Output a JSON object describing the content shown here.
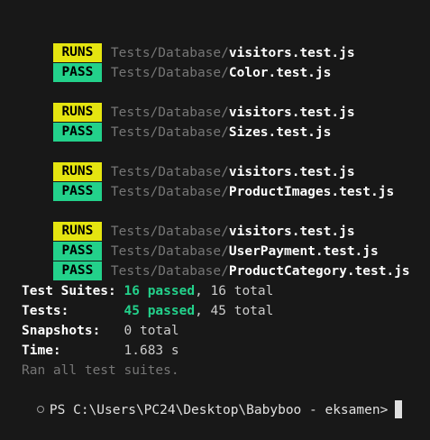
{
  "results": [
    {
      "status": "RUNS",
      "dir": "Tests/Database/",
      "file": "visitors.test.js"
    },
    {
      "status": "PASS",
      "dir": "Tests/Database/",
      "file": "Color.test.js"
    },
    {
      "status": "RUNS",
      "dir": "Tests/Database/",
      "file": "visitors.test.js"
    },
    {
      "status": "PASS",
      "dir": "Tests/Database/",
      "file": "Sizes.test.js"
    },
    {
      "status": "RUNS",
      "dir": "Tests/Database/",
      "file": "visitors.test.js"
    },
    {
      "status": "PASS",
      "dir": "Tests/Database/",
      "file": "ProductImages.test.js"
    },
    {
      "status": "RUNS",
      "dir": "Tests/Database/",
      "file": "visitors.test.js"
    },
    {
      "status": "PASS",
      "dir": "Tests/Database/",
      "file": "UserPayment.test.js"
    },
    {
      "status": "PASS",
      "dir": "Tests/Database/",
      "file": "ProductCategory.test.js"
    }
  ],
  "summary": {
    "suites_label": "Test Suites:",
    "suites_passed": "16 passed",
    "suites_total": ", 16 total",
    "tests_label": "Tests:",
    "tests_passed": "45 passed",
    "tests_total": ", 45 total",
    "snapshots_label": "Snapshots:",
    "snapshots_value": "0 total",
    "time_label": "Time:",
    "time_value": "1.683 s",
    "ran_all": "Ran all test suites."
  },
  "prompt": {
    "text": "PS C:\\Users\\PC24\\Desktop\\Babyboo - eksamen>"
  },
  "colors": {
    "background": "#181818",
    "runs_badge": "#e5e510",
    "pass_badge": "#23d18b",
    "passed_text": "#23d18b",
    "dim_text": "#767676"
  }
}
